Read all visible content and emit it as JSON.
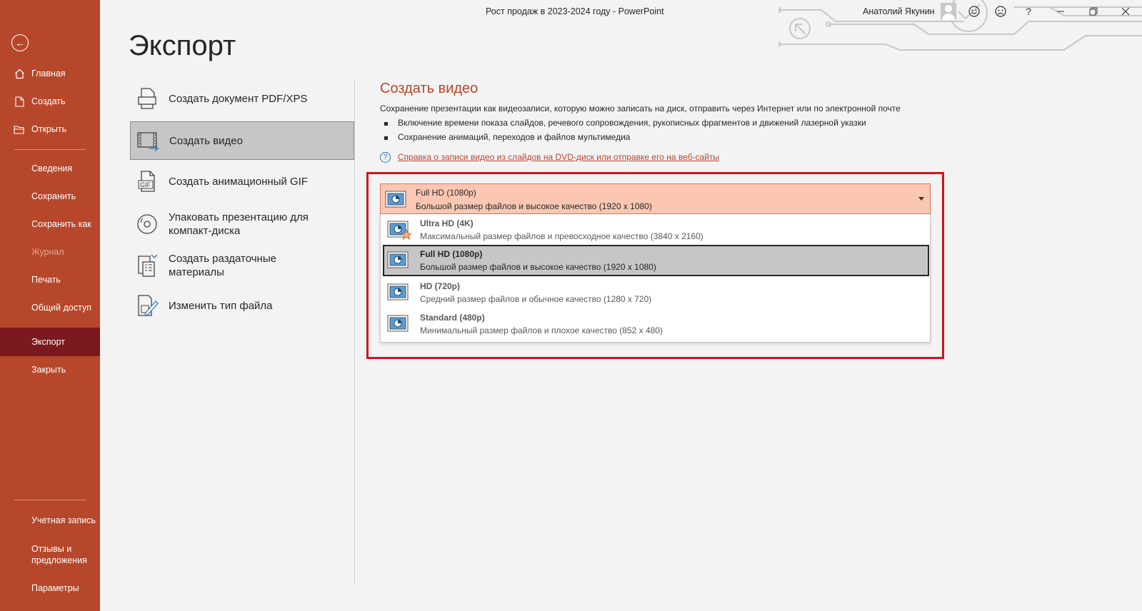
{
  "window": {
    "title": "Рост продаж в 2023-2024 году  -  PowerPoint",
    "user": "Анатолий Якунин",
    "help": "?"
  },
  "nav": {
    "home": "Главная",
    "new": "Создать",
    "open": "Открыть",
    "info": "Сведения",
    "save": "Сохранить",
    "save_as": "Сохранить как",
    "history": "Журнал",
    "print": "Печать",
    "share": "Общий доступ",
    "export": "Экспорт",
    "close": "Закрыть",
    "account": "Учетная запись",
    "feedback": "Отзывы и предложения",
    "options": "Параметры"
  },
  "page": {
    "title": "Экспорт"
  },
  "export_items": {
    "pdf": "Создать документ PDF/XPS",
    "video": "Создать видео",
    "gif": "Создать анимационный GIF",
    "package": "Упаковать презентацию для компакт-диска",
    "handouts": "Создать раздаточные материалы",
    "change_type": "Изменить тип файла"
  },
  "panel": {
    "title": "Создать видео",
    "description": "Сохранение презентации как видеозаписи, которую можно записать на диск, отправить через Интернет или по электронной почте",
    "bullet1": "Включение времени показа слайдов, речевого сопровождения, рукописных фрагментов и движений лазерной указки",
    "bullet2": "Сохранение анимаций, переходов и файлов мультимедиа",
    "help_link": "Справка о записи видео из слайдов на DVD-диск или отправке его на веб-сайты"
  },
  "quality": {
    "selected_name": "Full HD (1080p)",
    "selected_desc": "Большой размер файлов и высокое качество (1920 x 1080)",
    "options": [
      {
        "name": "Ultra HD (4K)",
        "desc": "Максимальный размер файлов и превосходное качество (3840 x 2160)"
      },
      {
        "name": "Full HD (1080p)",
        "desc": "Большой размер файлов и высокое качество (1920 x 1080)"
      },
      {
        "name": "HD (720p)",
        "desc": "Средний размер файлов и обычное качество (1280 x 720)"
      },
      {
        "name": "Standard (480p)",
        "desc": "Минимальный размер файлов и плохое качество (852 x 480)"
      }
    ]
  },
  "colors": {
    "accent": "#b7472a",
    "nav_active": "#7a1a1e",
    "highlight_box": "#d1141f",
    "combo_fill": "#fbc7b2"
  }
}
